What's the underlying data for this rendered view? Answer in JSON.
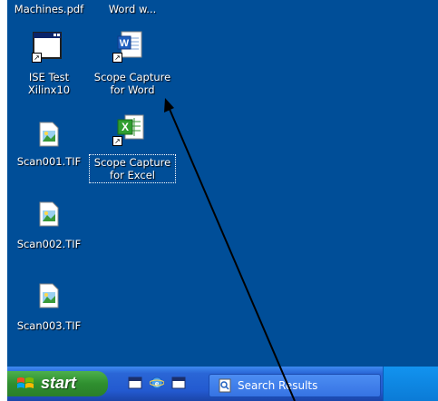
{
  "desktop": {
    "top_partial_labels": [
      "Machines.pdf",
      "Word w..."
    ],
    "icons": [
      {
        "name": "ise-test-xilinx",
        "line1": "ISE Test",
        "line2": "Xilinx10",
        "icon": "app-window-icon"
      },
      {
        "name": "scope-capture-word",
        "line1": "Scope Capture",
        "line2": "for Word",
        "icon": "word-document-icon"
      },
      {
        "name": "scope-capture-excel",
        "line1": "Scope Capture",
        "line2": "for Excel",
        "icon": "excel-spreadsheet-icon"
      },
      {
        "name": "scan001",
        "line1": "Scan001.TIF",
        "icon": "tif-image-icon"
      },
      {
        "name": "scan002",
        "line1": "Scan002.TIF",
        "icon": "tif-image-icon"
      },
      {
        "name": "scan003",
        "line1": "Scan003.TIF",
        "icon": "tif-image-icon"
      }
    ]
  },
  "taskbar": {
    "start_label": "start",
    "quick_launch": [
      "show-desktop-icon",
      "internet-explorer-icon",
      "window-icon"
    ],
    "window_item": {
      "label": "Search Results",
      "icon": "search-results-icon"
    }
  },
  "colors": {
    "desktop_bg": "#004e98",
    "taskbar": "#235ad0",
    "start_green": "#3a9a3a",
    "tray": "#0f8ae5",
    "excel_green": "#2f9e2f",
    "word_blue": "#1f5fbf"
  }
}
